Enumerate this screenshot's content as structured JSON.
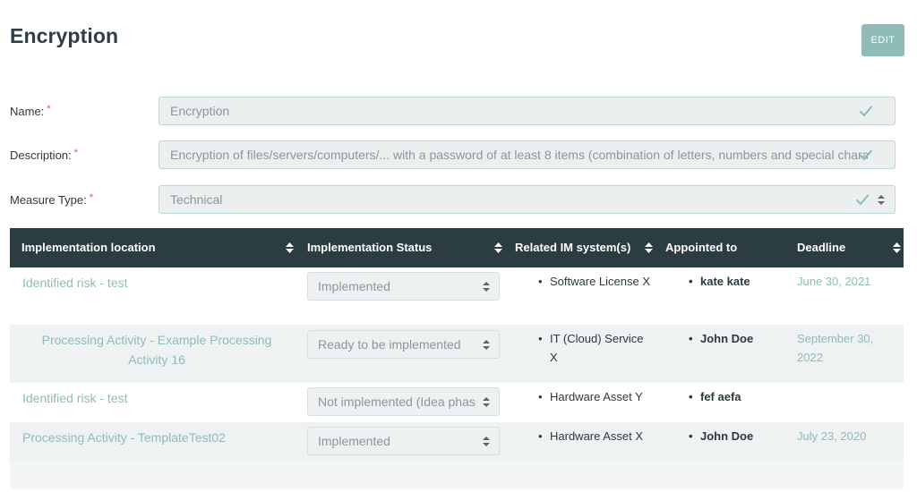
{
  "page": {
    "title": "Encryption",
    "edit_label": "EDIT"
  },
  "form": {
    "required_mark": "*",
    "name": {
      "label": "Name:",
      "value": "Encryption"
    },
    "description": {
      "label": "Description:",
      "value": "Encryption of files/servers/computers/... with a password of at least 8 items (combination of letters, numbers and special characters)"
    },
    "measure_type": {
      "label": "Measure Type:",
      "value": "Technical"
    }
  },
  "table": {
    "columns": [
      "Implementation location",
      "Implementation Status",
      "Related IM system(s)",
      "Appointed to",
      "Deadline"
    ],
    "rows": [
      {
        "location": "Identified risk - test",
        "status": "Implemented",
        "systems": "Software License X",
        "appointed": "kate kate",
        "deadline": "June 30, 2021"
      },
      {
        "location": "Processing Activity - Example Processing Activity 16",
        "status": "Ready to be implemented",
        "systems": "IT (Cloud) Service X",
        "appointed": "John Doe",
        "deadline": "September 30, 2022"
      },
      {
        "location": "Identified risk - test",
        "status": "Not implemented (Idea phase)",
        "systems": "Hardware Asset Y",
        "appointed": "fef aefa",
        "deadline": ""
      },
      {
        "location": "Processing Activity - TemplateTest02",
        "status": "Implemented",
        "systems": "Hardware Asset X",
        "appointed": "John Doe",
        "deadline": "July 23, 2020"
      }
    ]
  },
  "colors": {
    "accent": "#8fbcb6",
    "header_bg": "#2c3d42",
    "required": "#e05252"
  },
  "icons": {
    "valid": "check-icon",
    "select": "sort-arrows-icon"
  }
}
